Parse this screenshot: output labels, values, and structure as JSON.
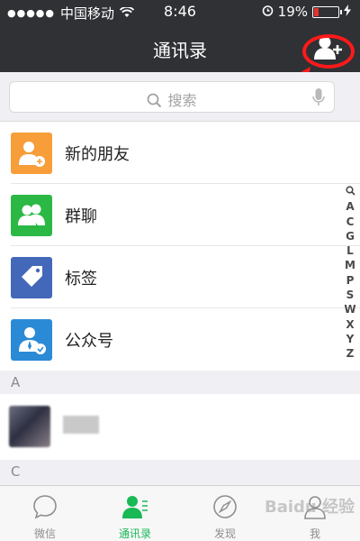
{
  "status_bar": {
    "carrier": "中国移动",
    "time": "8:46",
    "battery": "19%",
    "battery_level": 0.19
  },
  "nav": {
    "title": "通讯录",
    "add_icon": "add-contact-icon"
  },
  "search": {
    "placeholder": "搜索",
    "search_icon": "search-icon",
    "mic_icon": "mic-icon"
  },
  "menu_items": [
    {
      "label": "新的朋友",
      "icon": "new-friend-icon",
      "color": "#f79d3a"
    },
    {
      "label": "群聊",
      "icon": "group-chat-icon",
      "color": "#2bb845"
    },
    {
      "label": "标签",
      "icon": "tag-icon",
      "color": "#4468b9"
    },
    {
      "label": "公众号",
      "icon": "official-account-icon",
      "color": "#2b8ad6"
    }
  ],
  "sections": [
    "A",
    "C"
  ],
  "index_letters": [
    "🔍",
    "A",
    "C",
    "G",
    "L",
    "M",
    "P",
    "S",
    "W",
    "X",
    "Y",
    "Z"
  ],
  "tabs": [
    {
      "label": "微信",
      "icon": "chat-icon",
      "active": false
    },
    {
      "label": "通讯录",
      "icon": "contacts-icon",
      "active": true
    },
    {
      "label": "发现",
      "icon": "discover-icon",
      "active": false
    },
    {
      "label": "我",
      "icon": "me-icon",
      "active": false
    }
  ],
  "watermark": "Baidu 经验",
  "colors": {
    "header": "#2f3135",
    "accent": "#19b955",
    "annotation": "#ff1a1a"
  }
}
